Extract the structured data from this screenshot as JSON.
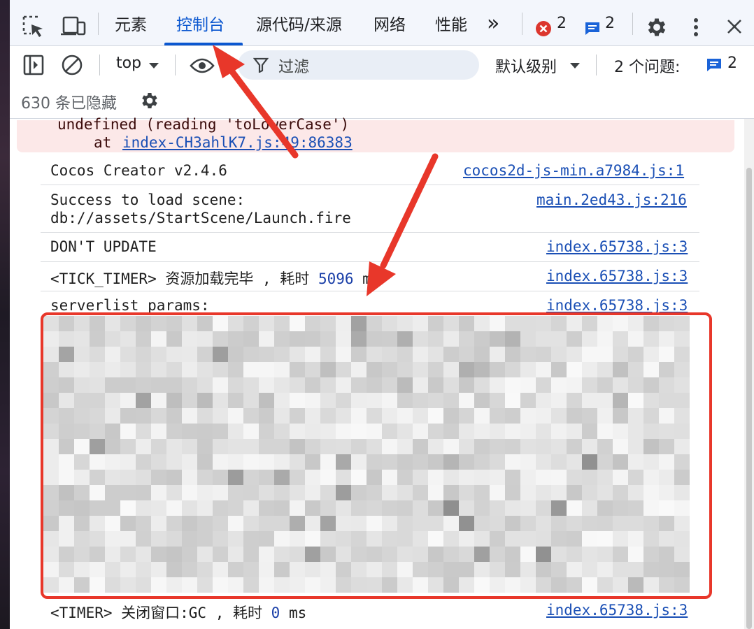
{
  "tabs": {
    "elements": "元素",
    "console": "控制台",
    "sources": "源代码/来源",
    "network": "网络",
    "performance": "性能",
    "more": "»"
  },
  "badges": {
    "errors": "2",
    "messages": "2"
  },
  "toolbar": {
    "context": "top",
    "filter_placeholder": "过滤",
    "levels": "默认级别",
    "issues_label": "2 个问题:",
    "issues_count": "2"
  },
  "hidden": {
    "text": "630 条已隐藏"
  },
  "console": {
    "error_line1": "undefined (reading 'toLowerCase')",
    "error_line2_prefix": "at ",
    "error_link": "index-CH3ahlK7.js:49:86383",
    "rows": [
      {
        "text": "Cocos Creator v2.4.6",
        "source": "cocos2d-js-min.a7984.js:1"
      },
      {
        "text": "Success to load scene:",
        "text2": "db://assets/StartScene/Launch.fire",
        "source": "main.2ed43.js:216"
      },
      {
        "text": "DON'T UPDATE",
        "source": "index.65738.js:3"
      },
      {
        "text_a": "<TICK_TIMER> 资源加载完毕 , 耗时 ",
        "num": "5096",
        "text_b": " ms",
        "source": "index.65738.js:3"
      },
      {
        "text": "serverlist params:",
        "source": "index.65738.js:3"
      },
      {
        "text_a": "<TIMER> 关闭窗口:GC , 耗时 ",
        "num": "0",
        "text_b": " ms",
        "source": "index.65738.js:3"
      }
    ]
  },
  "colors": {
    "accent": "#0b57d0",
    "error_bg": "#fce8e8",
    "annotation_red": "#e8372a",
    "link": "#1a4fb5"
  }
}
